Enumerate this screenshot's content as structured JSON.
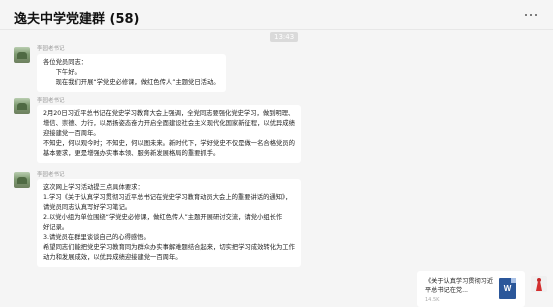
{
  "header": {
    "title": "逸夫中学党建群 (58)"
  },
  "timestamp": "13:43",
  "messages": [
    {
      "sender": "李园老书记",
      "lines": [
        "各位党员同志：",
        "　　下午好。",
        "　　现在我们开展“学党史必修课，做红色传人”主题党日活动。"
      ]
    },
    {
      "sender": "李园老书记",
      "lines": [
        "2月20日习近平总书记在党史学习教育大会上强调，全党同志要强化党史学习，做到明理、",
        "增信、崇德、力行，以昂扬姿态奋力开启全面建设社会主义现代化国家新征程，以优异成绩",
        "迎接建党一百周年。",
        "不知史，何以观今时；不知史，何以图未来。新时代下，学好党史不仅是做一名合格党员的",
        "基本要求，更是增强办实事本领、服务新发展格局的重要抓手。"
      ]
    },
    {
      "sender": "李园老书记",
      "lines": [
        "这次网上学习活动提三点具体要求：",
        "1.学习《关于认真学习贯彻习近平总书记在党史学习教育动员大会上的重要讲话的通知》，",
        "请党员同志认真写好学习笔记。",
        "2.以党小组为单位围绕“学党史必修课，做红色传人”主题开展研讨交流，请党小组长作",
        "好记录。",
        "3.请党员在群里谈谈自己的心得感悟。",
        "希望同志们能把党史学习教育同为群众办实事解难题结合起来，切实把学习成效转化为工作",
        "动力和发展成效，以优异成绩迎接建党一百周年。"
      ]
    }
  ],
  "file": {
    "name": "《关于认真学习贯彻习近平总书记在党...",
    "size": "14.5K",
    "icon": "word-doc-icon",
    "icon_letter": "W"
  }
}
